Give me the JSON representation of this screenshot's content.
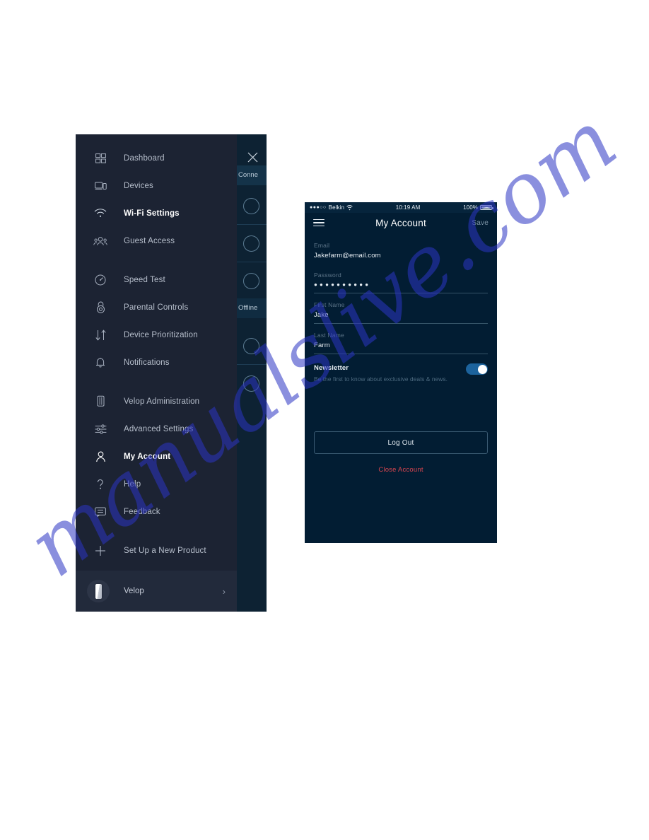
{
  "sidebar": {
    "close_icon": "close-icon",
    "items": [
      {
        "label": "Dashboard",
        "icon": "dashboard-icon",
        "active": false
      },
      {
        "label": "Devices",
        "icon": "devices-icon",
        "active": false
      },
      {
        "label": "Wi-Fi Settings",
        "icon": "wifi-icon",
        "active": true
      },
      {
        "label": "Guest Access",
        "icon": "guest-access-icon",
        "active": false
      },
      {
        "label": "Speed Test",
        "icon": "speedometer-icon",
        "active": false
      },
      {
        "label": "Parental Controls",
        "icon": "lock-icon",
        "active": false
      },
      {
        "label": "Device Prioritization",
        "icon": "arrows-updown-icon",
        "active": false
      },
      {
        "label": "Notifications",
        "icon": "bell-icon",
        "active": false
      },
      {
        "label": "Velop Administration",
        "icon": "velop-node-icon",
        "active": false
      },
      {
        "label": "Advanced Settings",
        "icon": "sliders-icon",
        "active": false
      },
      {
        "label": "My Account",
        "icon": "person-icon",
        "active": true
      },
      {
        "label": "Help",
        "icon": "question-mark-icon",
        "active": false
      },
      {
        "label": "Feedback",
        "icon": "chat-bubble-icon",
        "active": false
      },
      {
        "label": "Set Up a New Product",
        "icon": "plus-icon",
        "active": false
      }
    ],
    "footer": {
      "device_name": "Velop",
      "avatar_icon": "velop-node-avatar",
      "chevron_icon": "chevron-right-icon"
    }
  },
  "behind_screen": {
    "connected_label": "Conne",
    "offline_label": "Offline"
  },
  "phone": {
    "status_bar": {
      "signal_dots": "●●●○○",
      "carrier": "Belkin",
      "wifi_icon": "wifi-status-icon",
      "time": "10:19 AM",
      "battery_percent": "100%",
      "battery_icon": "battery-full-icon"
    },
    "app_bar": {
      "menu_icon": "hamburger-menu-icon",
      "title": "My Account",
      "save_label": "Save"
    },
    "fields": [
      {
        "label": "Email",
        "value": "Jakefarm@email.com",
        "type": "text"
      },
      {
        "label": "Password",
        "value": "●●●●●●●●●●",
        "type": "password"
      },
      {
        "label": "First Name",
        "value": "Jake",
        "type": "text"
      },
      {
        "label": "Last Name",
        "value": "Farm",
        "type": "text"
      }
    ],
    "newsletter": {
      "title": "Newsletter",
      "description": "Be the first to know about exclusive deals & news.",
      "toggle_state": "on"
    },
    "logout_label": "Log Out",
    "close_account_label": "Close Account"
  },
  "watermark": {
    "text": "manualslive.com"
  },
  "colors": {
    "drawer_bg": "#1c2333",
    "phone_bg": "#021d33",
    "accent_blue": "#1c639d",
    "danger_red": "#d9454f",
    "watermark_blue": "#2b35c4"
  }
}
